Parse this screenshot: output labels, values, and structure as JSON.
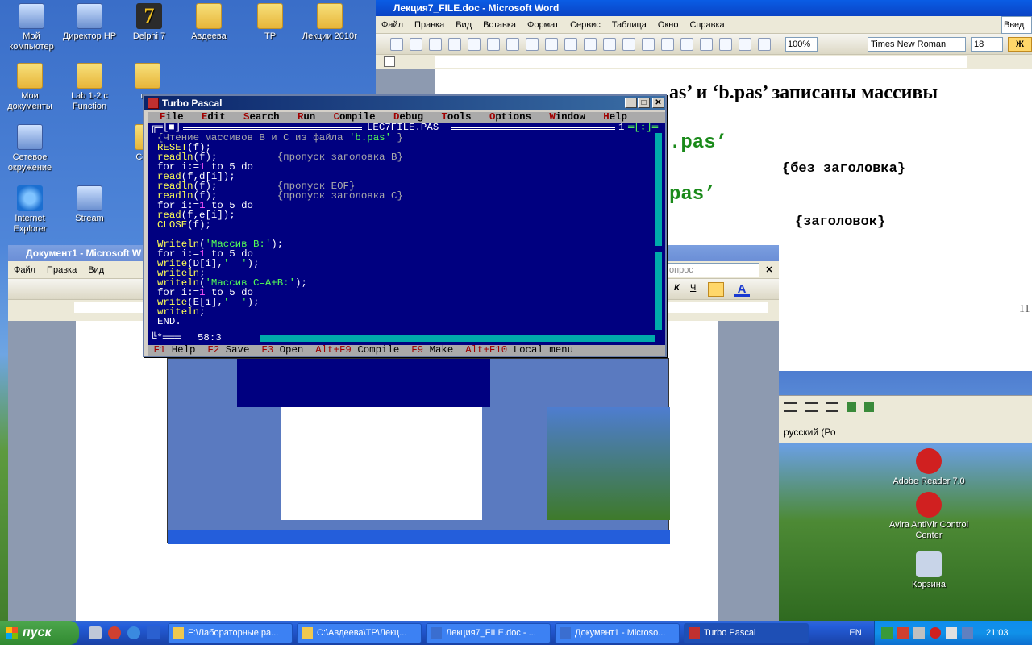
{
  "desktop": {
    "icons": [
      {
        "label": "Мой компьютер",
        "kind": "comp"
      },
      {
        "label": "Директор HP",
        "kind": "comp"
      },
      {
        "label": "Delphi 7",
        "kind": "d7"
      },
      {
        "label": "Авдеева",
        "kind": "folder"
      },
      {
        "label": "TP",
        "kind": "folder"
      },
      {
        "label": "Лекции 2010г",
        "kind": "folder"
      },
      {
        "label": "Мои документы",
        "kind": "folder"
      },
      {
        "label": "Lab 1-2 с Function",
        "kind": "folder"
      },
      {
        "label": "пак",
        "kind": "folder"
      },
      {
        "label": "Сетевое окружение",
        "kind": "comp"
      },
      {
        "label": "Co ра",
        "kind": "folder"
      },
      {
        "label": "Internet Explorer",
        "kind": "ie"
      },
      {
        "label": "Stream",
        "kind": "comp"
      }
    ],
    "right_icons": [
      {
        "label": "Adobe Reader 7.0"
      },
      {
        "label": "Avira AntiVir Control Center"
      },
      {
        "label": "Корзина"
      }
    ]
  },
  "word_main": {
    "title": "Лекция7_FILE.doc - Microsoft Word",
    "menu": [
      "Файл",
      "Правка",
      "Вид",
      "Вставка",
      "Формат",
      "Сервис",
      "Таблица",
      "Окно",
      "Справка"
    ],
    "zoom": "100%",
    "font": "Times New Roman",
    "size": "18",
    "question_stub": "Введ",
    "text_line1": "as’ и ‘b.pas’ записаны массивы",
    "text_green1": ".pas’",
    "text_comment1": "{без заголовка}",
    "text_green2": "pas’",
    "text_comment2": "{заголовок}",
    "page_num": "11"
  },
  "word_doc1": {
    "title": "Документ1 - Microsoft W",
    "menu": [
      "Файл",
      "Правка",
      "Вид"
    ],
    "question": "опрос"
  },
  "tp": {
    "title": "Turbo Pascal",
    "menu": [
      {
        "hk": "F",
        "rest": "ile"
      },
      {
        "hk": "E",
        "rest": "dit"
      },
      {
        "hk": "S",
        "rest": "earch"
      },
      {
        "hk": "R",
        "rest": "un"
      },
      {
        "hk": "C",
        "rest": "ompile"
      },
      {
        "hk": "D",
        "rest": "ebug"
      },
      {
        "hk": "T",
        "rest": "ools"
      },
      {
        "hk": "O",
        "rest": "ptions"
      },
      {
        "hk": "W",
        "rest": "indow"
      },
      {
        "hk": "H",
        "rest": "elp"
      }
    ],
    "filename": "LEC7FILE.PAS",
    "window_num": "1",
    "cursor_pos": "58:3",
    "code": [
      "{Чтение массивов B и C из файла 'b.pas' }",
      "RESET(f);",
      "readln(f);          {пропуск заголовка B}",
      "for i:=1 to 5 do",
      "read(f,d[i]);",
      "readln(f);          {пропуск EOF}",
      "readln(f);          {пропуск заголовка C}",
      "for i:=1 to 5 do",
      "read(f,e[i]);",
      "CLOSE(f);",
      "",
      "Writeln('Массив B:');",
      "for i:=1 to 5 do",
      "write(D[i],'  ');",
      "writeln;",
      "writeln('Массив C=A+B:');",
      "for i:=1 to 5 do",
      "write(E[i],'  ');",
      "writeln;",
      "END."
    ],
    "status": [
      {
        "key": "F1",
        "label": "Help"
      },
      {
        "key": "F2",
        "label": "Save"
      },
      {
        "key": "F3",
        "label": "Open"
      },
      {
        "key": "Alt+F9",
        "label": "Compile"
      },
      {
        "key": "F9",
        "label": "Make"
      },
      {
        "key": "Alt+F10",
        "label": "Local menu"
      }
    ]
  },
  "right_panel": {
    "lang": "русский (Ро"
  },
  "taskbar": {
    "start": "пуск",
    "tasks": [
      {
        "label": "F:\\Лабораторные ра...",
        "active": false
      },
      {
        "label": "C:\\Авдеева\\TP\\Лекц...",
        "active": false
      },
      {
        "label": "Лекция7_FILE.doc - ...",
        "active": false
      },
      {
        "label": "Документ1 - Microso...",
        "active": false
      },
      {
        "label": "Turbo Pascal",
        "active": true
      }
    ],
    "lang": "EN",
    "clock": "21:03"
  },
  "colors": {
    "tp_bg": "#000080",
    "tp_keyword": "#ffffff",
    "tp_ident": "#ffff55",
    "tp_number": "#ff55ff",
    "tp_string": "#55ff55",
    "word_green": "#1a8a1a"
  }
}
